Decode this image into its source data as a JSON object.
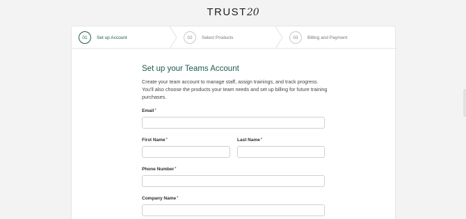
{
  "logo": {
    "text": "TRUST",
    "num": "20"
  },
  "steps": [
    {
      "num": "01",
      "label": "Set up Account",
      "active": true
    },
    {
      "num": "02",
      "label": "Select Products",
      "active": false
    },
    {
      "num": "03",
      "label": "Billing and Payment",
      "active": false
    }
  ],
  "form": {
    "title": "Set up your Teams Account",
    "description": "Create your team account to manage staff, assign trainings, and track progress. You'll also choose the products your team needs and set up billing for future training purchases.",
    "required_mark": "*",
    "fields": {
      "email": {
        "label": "Email",
        "value": ""
      },
      "first_name": {
        "label": "First Name",
        "value": ""
      },
      "last_name": {
        "label": "Last Name",
        "value": ""
      },
      "phone": {
        "label": "Phone Number",
        "value": ""
      },
      "company": {
        "label": "Company Name",
        "value": ""
      }
    }
  },
  "colors": {
    "accent": "#1e5a4f",
    "required": "#c0392b",
    "background": "#f3f3f4"
  }
}
